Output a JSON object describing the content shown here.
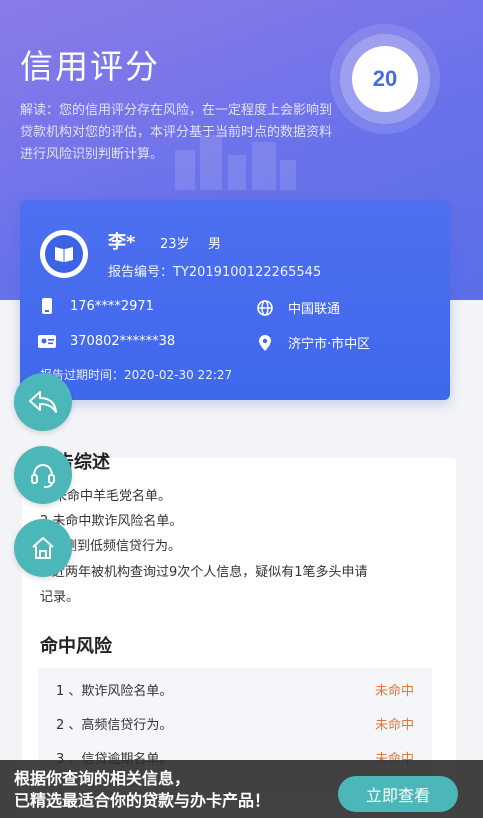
{
  "header": {
    "title": "信用评分",
    "score": "20",
    "description": "解读：您的信用评分存在风险，在一定程度上会影响到贷款机构对您的评估，本评分基于当前时点的数据资料进行风险识别判断计算。"
  },
  "profile": {
    "name": "李*",
    "age": "23岁",
    "gender": "男",
    "report_no": "报告编号：TY2019100122265545",
    "phone": "176****2971",
    "carrier": "中国联通",
    "id_no": "370802******38",
    "location": "济宁市·市中区",
    "expire": "报告过期时间：2020-02-30 22:27"
  },
  "summary": {
    "title": "告综述",
    "lines": [
      "未命中羊毛党名单。",
      "2.未命中欺诈风险名单。",
      "测到低频信贷行为。",
      "近两年被机构查询过9次个人信息，疑似有1笔多头申请",
      "记录。"
    ]
  },
  "risk": {
    "title": "命中风险",
    "items": [
      {
        "label": "1 、欺诈风险名单。",
        "status": "未命中"
      },
      {
        "label": "2 、高频信贷行为。",
        "status": "未命中"
      },
      {
        "label": "3 、信贷逾期名单。",
        "status": "未命中"
      }
    ]
  },
  "banner": {
    "line1": "根据你查询的相关信息，",
    "line2": "已精选最适合你的贷款与办卡产品！",
    "cta": "立即查看"
  },
  "colors": {
    "accent_blue": "#4e6ff0",
    "teal": "#4bb7b9",
    "status_orange": "#e07a3c"
  }
}
